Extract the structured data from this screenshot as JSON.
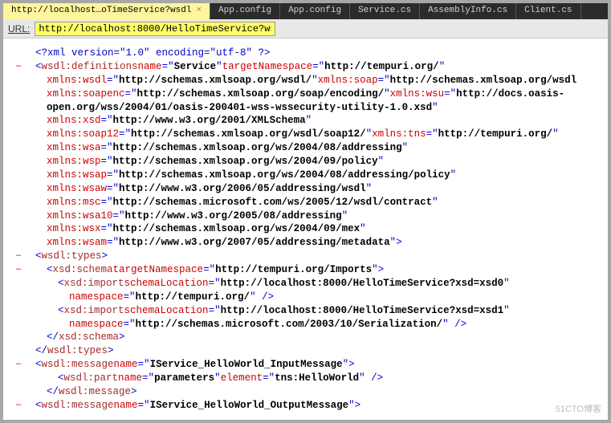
{
  "tabs": [
    {
      "label": "http://localhost…oTimeService?wsdl",
      "active": true,
      "close": "×"
    },
    {
      "label": "App.config"
    },
    {
      "label": "App.config"
    },
    {
      "label": "Service.cs"
    },
    {
      "label": "AssemblyInfo.cs"
    },
    {
      "label": "Client.cs"
    }
  ],
  "urlbar": {
    "label": "URL:",
    "value": "http://localhost:8000/HelloTimeService?wsdl"
  },
  "xml": {
    "decl": "<?xml version=\"1.0\" encoding=\"utf-8\" ?>",
    "def_open": "wsdl:definitions",
    "def_name_attr": "name",
    "def_name_val": "Service",
    "def_tn_attr": "targetNamespace",
    "def_tn_val": "http://tempuri.org/",
    "ns": [
      {
        "a": "xmlns:wsdl",
        "v": "http://schemas.xmlsoap.org/wsdl/",
        "a2": "xmlns:soap",
        "v2": "http://schemas.xmlsoap.org/wsdl"
      },
      {
        "a": "xmlns:soapenc",
        "v": "http://schemas.xmlsoap.org/soap/encoding/",
        "a2": "xmlns:wsu",
        "v2": "http://docs.oasis-"
      },
      {
        "cont": "open.org/wss/2004/01/oasis-200401-wss-wssecurity-utility-1.0.xsd"
      },
      {
        "a": "xmlns:xsd",
        "v": "http://www.w3.org/2001/XMLSchema"
      },
      {
        "a": "xmlns:soap12",
        "v": "http://schemas.xmlsoap.org/wsdl/soap12/",
        "a2": "xmlns:tns",
        "v2": "http://tempuri.org/"
      },
      {
        "a": "xmlns:wsa",
        "v": "http://schemas.xmlsoap.org/ws/2004/08/addressing"
      },
      {
        "a": "xmlns:wsp",
        "v": "http://schemas.xmlsoap.org/ws/2004/09/policy"
      },
      {
        "a": "xmlns:wsap",
        "v": "http://schemas.xmlsoap.org/ws/2004/08/addressing/policy"
      },
      {
        "a": "xmlns:wsaw",
        "v": "http://www.w3.org/2006/05/addressing/wsdl"
      },
      {
        "a": "xmlns:msc",
        "v": "http://schemas.microsoft.com/ws/2005/12/wsdl/contract"
      },
      {
        "a": "xmlns:wsa10",
        "v": "http://www.w3.org/2005/08/addressing"
      },
      {
        "a": "xmlns:wsx",
        "v": "http://schemas.xmlsoap.org/ws/2004/09/mex"
      },
      {
        "a": "xmlns:wsam",
        "v": "http://www.w3.org/2007/05/addressing/metadata",
        "close": ">"
      }
    ],
    "types_open": "wsdl:types",
    "schema_open": "xsd:schema",
    "schema_tn_attr": "targetNamespace",
    "schema_tn_val": "http://tempuri.org/Imports",
    "imports": [
      {
        "sl_attr": "schemaLocation",
        "sl_val": "http://localhost:8000/HelloTimeService?xsd=xsd0",
        "ns_attr": "namespace",
        "ns_val": "http://tempuri.org/"
      },
      {
        "sl_attr": "schemaLocation",
        "sl_val": "http://localhost:8000/HelloTimeService?xsd=xsd1",
        "ns_attr": "namespace",
        "ns_val": "http://schemas.microsoft.com/2003/10/Serialization/"
      }
    ],
    "import_tag": "xsd:import",
    "schema_close": "xsd:schema",
    "types_close": "wsdl:types",
    "msg1_tag": "wsdl:message",
    "msg1_name_attr": "name",
    "msg1_name_val": "IService_HelloWorld_InputMessage",
    "part_tag": "wsdl:part",
    "part_name_attr": "name",
    "part_name_val": "parameters",
    "part_el_attr": "element",
    "part_el_val": "tns:HelloWorld",
    "msg1_close": "wsdl:message",
    "msg2_tag": "wsdl:message",
    "msg2_name_attr": "name",
    "msg2_name_val": "IService_HelloWorld_OutputMessage"
  },
  "watermark": "51CTO博客"
}
